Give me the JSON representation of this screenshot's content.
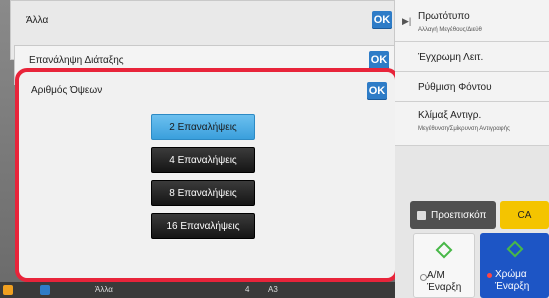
{
  "header": {
    "alla_label": "Άλλα",
    "ok_label": "OK",
    "repeat_layout_label": "Επανάληψη Διάταξης"
  },
  "dialog": {
    "title": "Αριθμός Όψεων",
    "ok_label": "OK",
    "options": [
      {
        "label": "2 Επαναλήψεις",
        "selected": true
      },
      {
        "label": "4 Επαναλήψεις",
        "selected": false
      },
      {
        "label": "8 Επαναλήψεις",
        "selected": false
      },
      {
        "label": "16 Επαναλήψεις",
        "selected": false
      }
    ]
  },
  "bottom_strip": {
    "alla_label": "Άλλα",
    "count": "4",
    "paper": "A3"
  },
  "right_panel": {
    "original_title": "Πρωτότυπο",
    "original_sub": "Αλλαγή Μεγέθους/Διεύθ",
    "color_mode": "Έγχρωμη Λειτ.",
    "background": "Ρύθμιση Φόντου",
    "scale_title": "Κλίμαξ Αντιγρ.",
    "scale_sub": "Μεγέθυνση/Σμίκρυνση Αντιγραφής",
    "preview_label": "Προεπισκόπ",
    "ca_label": "CA",
    "bw_start_line1": "Α/Μ",
    "bw_start_line2": "Έναρξη",
    "color_start_line1": "Χρώμα",
    "color_start_line2": "Έναρξη"
  },
  "colors": {
    "accent_blue": "#2e7cc7",
    "selected_blue": "#4aa8e2",
    "dialog_border_red": "#e8243a",
    "ca_yellow": "#f4c400",
    "color_start_blue": "#1d55c5"
  },
  "icons": {
    "original_arrow": "play-bar-icon",
    "preview": "preview-icon",
    "start": "diamond-start-icon"
  }
}
